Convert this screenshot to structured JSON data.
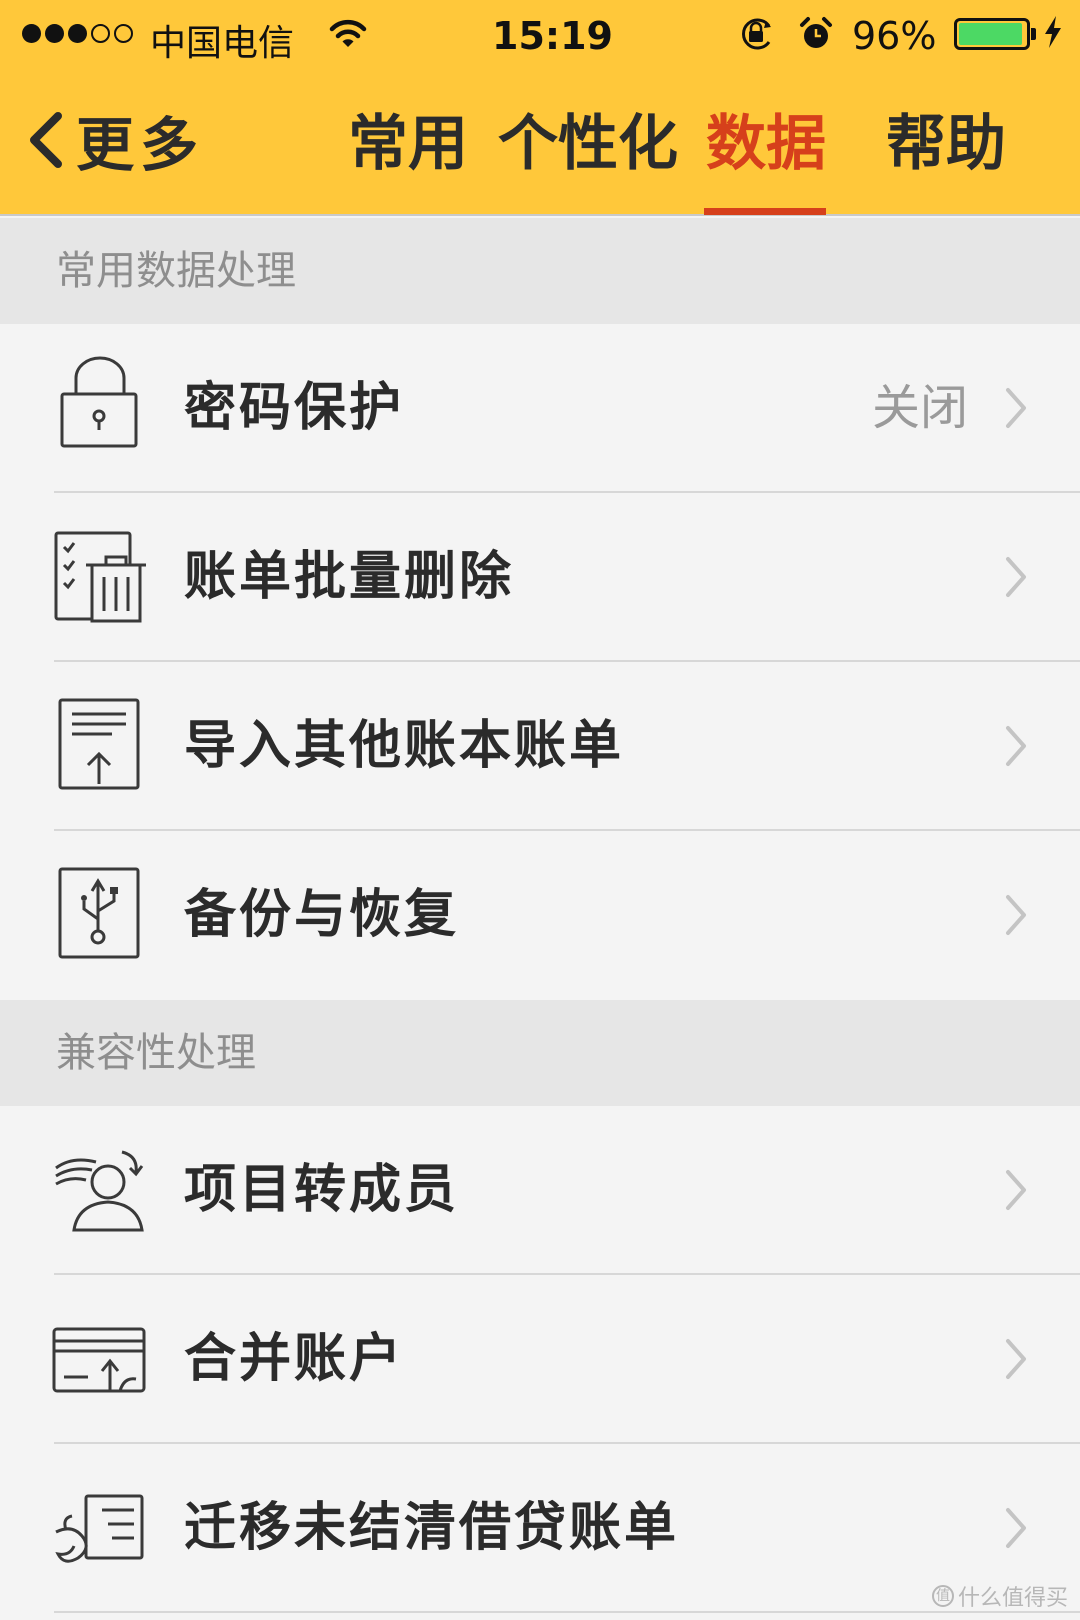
{
  "status_bar": {
    "carrier": "中国电信",
    "time": "15:19",
    "battery_percent": "96%",
    "battery_level": 0.96,
    "signal_bars_filled": 3,
    "signal_bars_total": 5
  },
  "nav": {
    "back_label": "更多",
    "tabs": [
      {
        "label": "常用",
        "active": false
      },
      {
        "label": "个性化",
        "active": false
      },
      {
        "label": "数据",
        "active": true
      },
      {
        "label": "帮助",
        "active": false
      }
    ]
  },
  "sections": [
    {
      "title": "常用数据处理",
      "items": [
        {
          "label": "密码保护",
          "value": "关闭",
          "icon": "lock-icon"
        },
        {
          "label": "账单批量删除",
          "value": "",
          "icon": "batch-delete-icon"
        },
        {
          "label": "导入其他账本账单",
          "value": "",
          "icon": "import-icon"
        },
        {
          "label": "备份与恢复",
          "value": "",
          "icon": "usb-backup-icon"
        }
      ]
    },
    {
      "title": "兼容性处理",
      "items": [
        {
          "label": "项目转成员",
          "value": "",
          "icon": "project-to-member-icon"
        },
        {
          "label": "合并账户",
          "value": "",
          "icon": "merge-account-icon"
        },
        {
          "label": "迁移未结清借贷账单",
          "value": "",
          "icon": "migrate-loan-icon"
        }
      ]
    }
  ],
  "watermark": "什么值得买",
  "colors": {
    "header_bg": "#ffc83a",
    "accent": "#d6401b",
    "section_bg": "#e6e6e6",
    "list_bg": "#f4f4f4"
  }
}
